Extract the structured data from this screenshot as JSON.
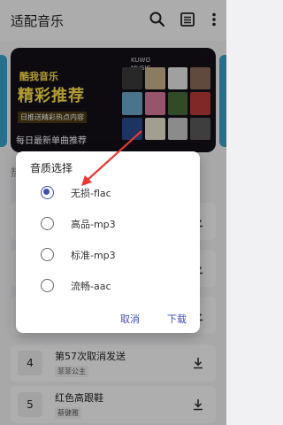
{
  "app": {
    "title": "适配音乐"
  },
  "banner": {
    "line1": "酷我音乐",
    "line2": "精彩推荐",
    "line3": "日推送精彩热点内容",
    "line4": "每日最新单曲推荐",
    "brand_top": "KUWO",
    "brand_bottom": "MUSIC"
  },
  "section": {
    "hot_label": "热门"
  },
  "songs": [
    {
      "num": "4",
      "title": "第57次取消发送",
      "artist": "菲菲公主"
    },
    {
      "num": "5",
      "title": "红色高跟鞋",
      "artist": "蔡健雅"
    }
  ],
  "dialog": {
    "title": "音质选择",
    "options": [
      {
        "label": "无损-flac",
        "selected": true
      },
      {
        "label": "高品-mp3",
        "selected": false
      },
      {
        "label": "标准-mp3",
        "selected": false
      },
      {
        "label": "流畅-aac",
        "selected": false
      }
    ],
    "cancel": "取消",
    "confirm": "下载"
  },
  "colors": {
    "accent": "#3f51b5",
    "annotation": "#e53935",
    "banner_text": "#ffe14a"
  },
  "icons": {
    "search": "search-icon",
    "list": "list-icon",
    "menu": "more-vert-icon",
    "download": "download-icon"
  }
}
